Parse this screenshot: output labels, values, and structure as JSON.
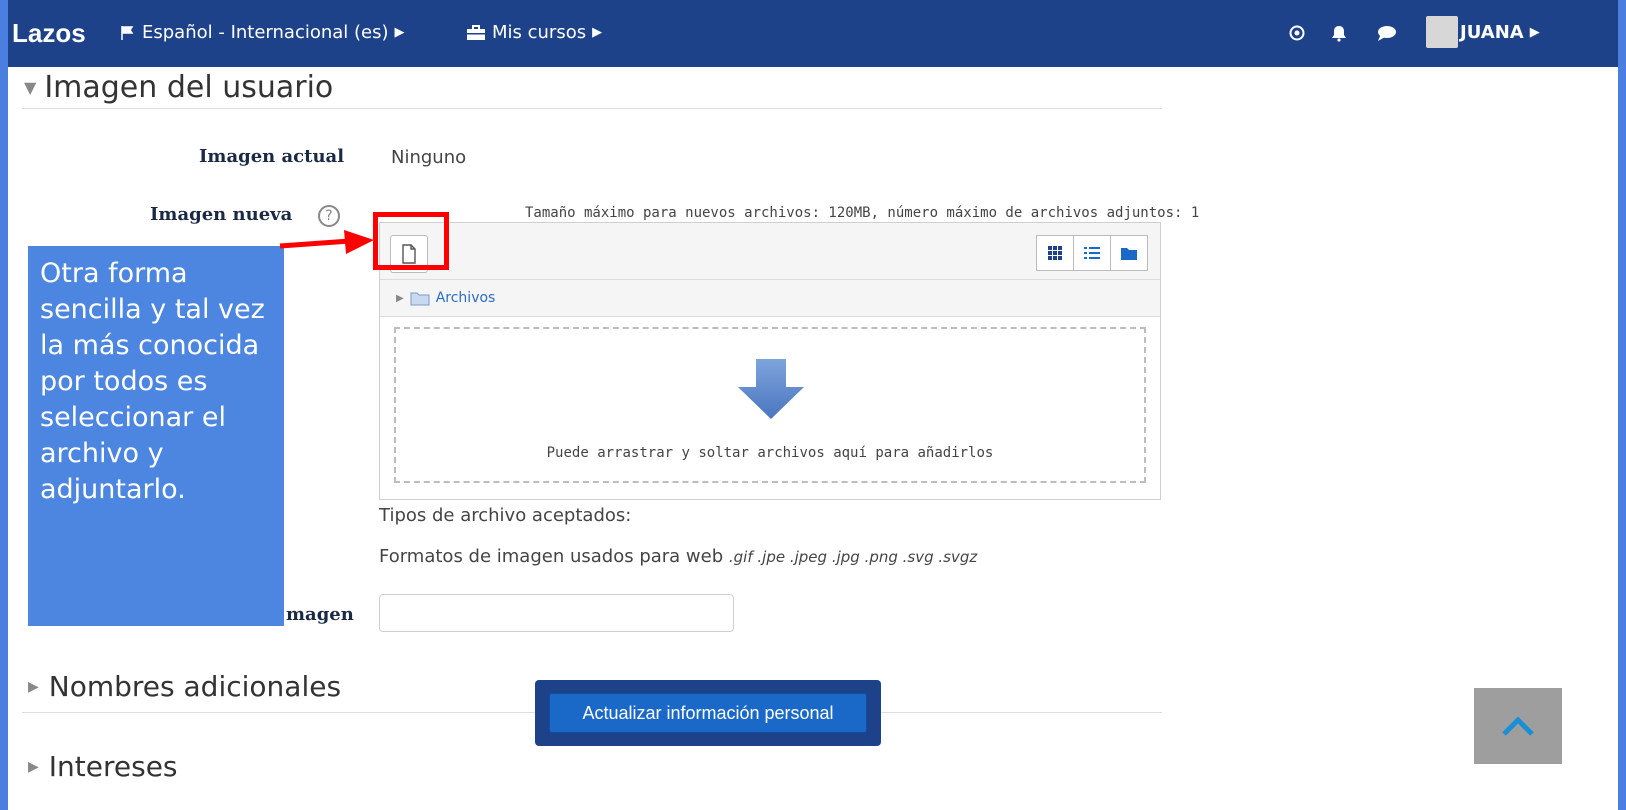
{
  "navbar": {
    "brand": "Lazos",
    "language": "Español - Internacional (es)",
    "courses": "Mis cursos",
    "user": "JUANA",
    "icons": [
      "flag-icon",
      "briefcase-icon",
      "help-circle-icon",
      "bell-icon",
      "chat-icon"
    ]
  },
  "user_picture": {
    "header": "Imagen del usuario",
    "current_label": "Imagen actual",
    "current_value": "Ninguno",
    "new_label": "Imagen nueva",
    "max_size": "Tamaño máximo para nuevos archivos: 120MB, número máximo de archivos adjuntos: 1",
    "folder_label": "Archivos",
    "drop_text": "Puede arrastrar y soltar archivos aquí para añadirlos",
    "accepted_types": "Tipos de archivo aceptados:",
    "formats_label": "Formatos de imagen usados para web",
    "formats_ext": ".gif .jpe .jpeg .jpg .png .svg .svgz",
    "description_label_visible": "magen",
    "description_value": ""
  },
  "sections": {
    "additional_names": "Nombres adicionales",
    "interests": "Intereses"
  },
  "actions": {
    "update_button": "Actualizar información personal"
  },
  "annotation": {
    "callout_text": "Otra forma sencilla y tal vez la más conocida por todos es seleccionar el archivo y adjuntarlo."
  },
  "colors": {
    "navbar": "#1d4289",
    "primary_button": "#1a69c9",
    "callout": "#4c86e0",
    "highlight": "#ff0000"
  }
}
